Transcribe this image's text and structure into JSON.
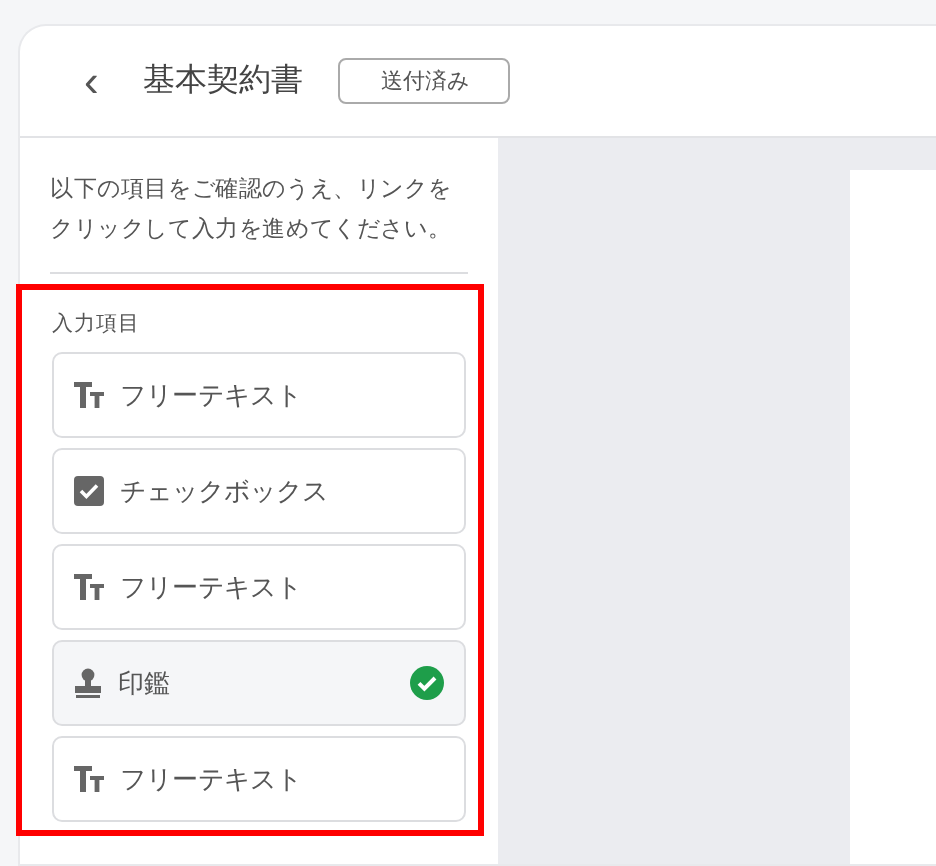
{
  "header": {
    "back": "‹",
    "title": "基本契約書",
    "status": "送付済み"
  },
  "sidebar": {
    "instruction": "以下の項目をご確認のうえ、リンクをクリックして入力を進めてください。",
    "section_label": "入力項目",
    "items": [
      {
        "kind": "text",
        "label": "フリーテキスト",
        "completed": false
      },
      {
        "kind": "checkbox",
        "label": "チェックボックス",
        "completed": false
      },
      {
        "kind": "text",
        "label": "フリーテキスト",
        "completed": false
      },
      {
        "kind": "stamp",
        "label": "印鑑",
        "completed": true
      },
      {
        "kind": "text",
        "label": "フリーテキスト",
        "completed": false
      }
    ]
  }
}
